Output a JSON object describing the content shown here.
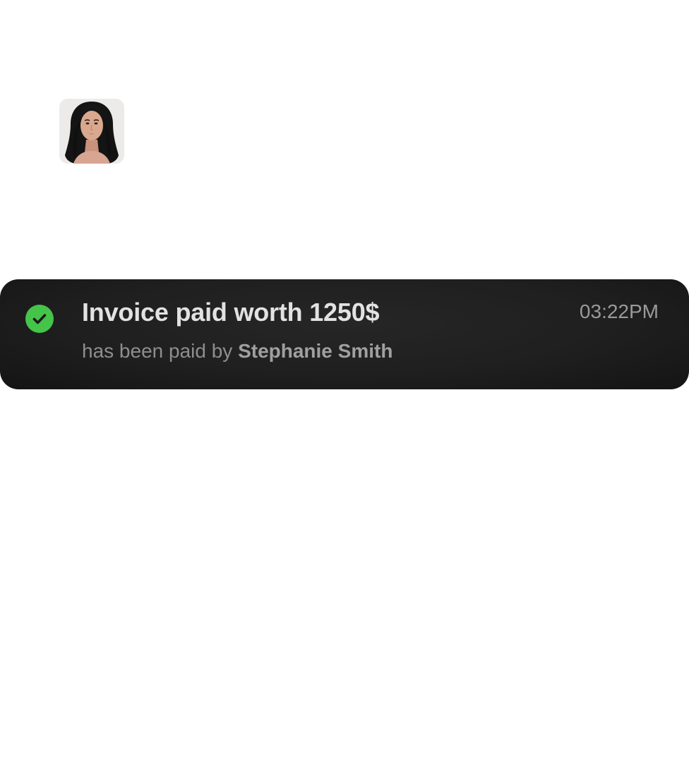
{
  "avatar": {
    "icon": "user-avatar-photo"
  },
  "notification": {
    "status_icon": "check-circle-icon",
    "status_color": "#45c44a",
    "title": "Invoice paid worth 1250$",
    "subtitle_prefix": "has been paid by",
    "payer": "Stephanie Smith",
    "time": "03:22PM"
  },
  "colors": {
    "toast_background": "#1f1f1f",
    "title_text": "#e2e2e2",
    "secondary_text": "#8e8e8e",
    "page_background": "#ffffff"
  }
}
